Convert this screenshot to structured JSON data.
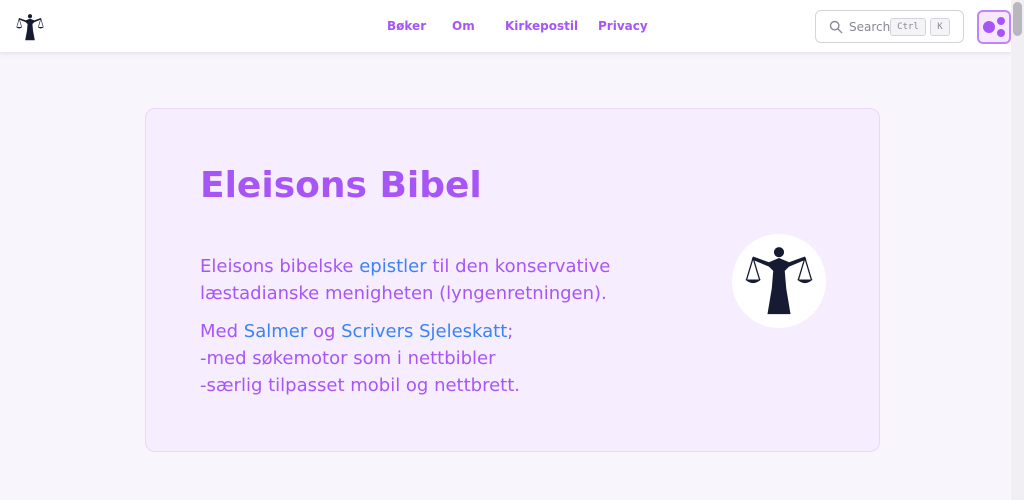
{
  "header": {
    "nav": [
      {
        "label": "Bøker"
      },
      {
        "label": "Om"
      },
      {
        "label": "Kirkepostil"
      },
      {
        "label": "Privacy"
      }
    ],
    "search": {
      "placeholder": "Search",
      "shortcut_ctrl": "Ctrl",
      "shortcut_key": "K"
    }
  },
  "hero": {
    "title": "Eleisons Bibel",
    "para1_part1": "Eleisons bibelske ",
    "para1_link": "epistler",
    "para1_part2": " til den konservative",
    "para1_line2": "læstadianske menigheten (lyngenretningen).",
    "para2_prefix": "Med ",
    "para2_link1": "Salmer",
    "para2_mid": " og ",
    "para2_link2": "Scrivers Sjeleskatt",
    "para2_suffix": ";",
    "para2_line2": "-med søkemotor som i nettbibler",
    "para2_line3": "-særlig tilpasset mobil og nettbrett."
  },
  "colors": {
    "accent": "#a855f7",
    "link": "#3b82f6",
    "card_bg": "#f6eefe"
  }
}
